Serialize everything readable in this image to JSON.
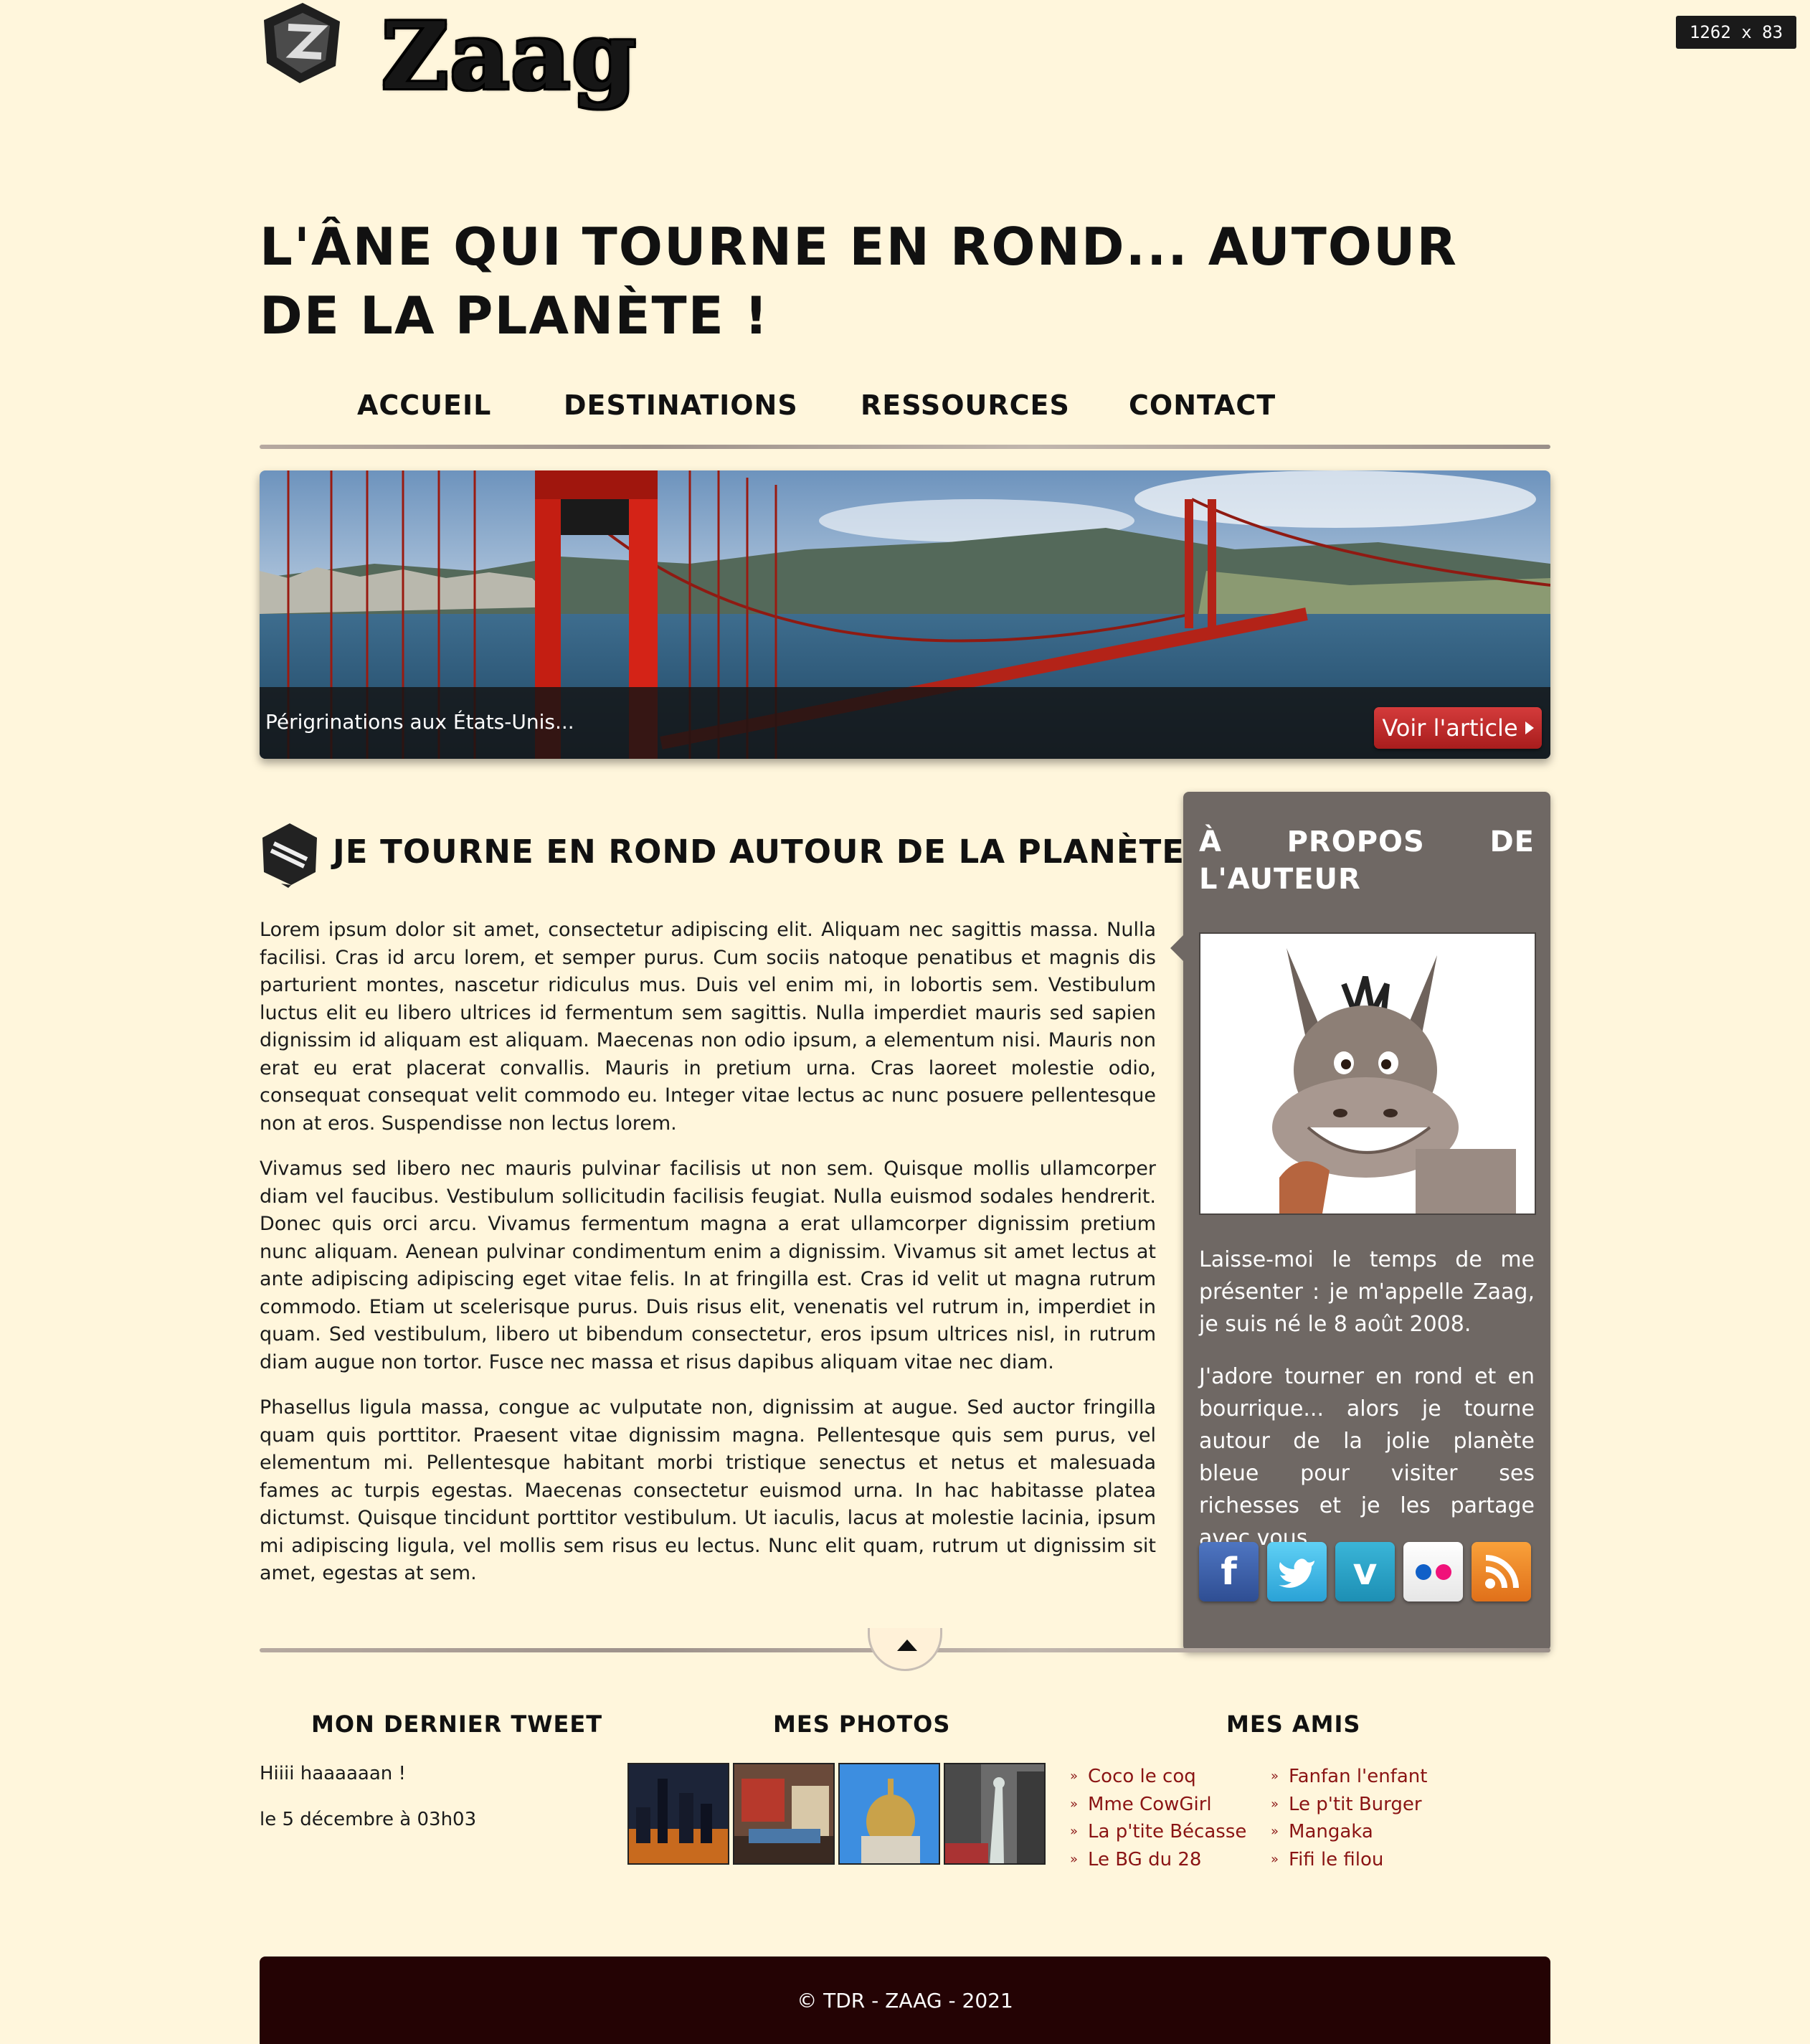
{
  "badge": {
    "resolution": "1262 x 83"
  },
  "header": {
    "logo_text": "Zaag",
    "site_title": "L'âne qui tourne en rond... autour de la planète !"
  },
  "nav": {
    "items": [
      "Accueil",
      "Destinations",
      "Ressources",
      "Contact"
    ]
  },
  "banner": {
    "caption": "Périgrinations aux États-Unis...",
    "button_label": "Voir l'article"
  },
  "article": {
    "title": "Je tourne en rond autour de la planète",
    "paragraphs": [
      "Lorem ipsum dolor sit amet, consectetur adipiscing elit. Aliquam nec sagittis massa. Nulla facilisi. Cras id arcu lorem, et semper purus. Cum sociis natoque penatibus et magnis dis parturient montes, nascetur ridiculus mus. Duis vel enim mi, in lobortis sem. Vestibulum luctus elit eu libero ultrices id fermentum sem sagittis. Nulla imperdiet mauris sed sapien dignissim id aliquam est aliquam. Maecenas non odio ipsum, a elementum nisi. Mauris non erat eu erat placerat convallis. Mauris in pretium urna. Cras laoreet molestie odio, consequat consequat velit commodo eu. Integer vitae lectus ac nunc posuere pellentesque non at eros. Suspendisse non lectus lorem.",
      "Vivamus sed libero nec mauris pulvinar facilisis ut non sem. Quisque mollis ullamcorper diam vel faucibus. Vestibulum sollicitudin facilisis feugiat. Nulla euismod sodales hendrerit. Donec quis orci arcu. Vivamus fermentum magna a erat ullamcorper dignissim pretium nunc aliquam. Aenean pulvinar condimentum enim a dignissim. Vivamus sit amet lectus at ante adipiscing adipiscing eget vitae felis. In at fringilla est. Cras id velit ut magna rutrum commodo. Etiam ut scelerisque purus. Duis risus elit, venenatis vel rutrum in, imperdiet in quam. Sed vestibulum, libero ut bibendum consectetur, eros ipsum ultrices nisl, in rutrum diam augue non tortor. Fusce nec massa et risus dapibus aliquam vitae nec diam.",
      "Phasellus ligula massa, congue ac vulputate non, dignissim at augue. Sed auctor fringilla quam quis porttitor. Praesent vitae dignissim magna. Pellentesque quis sem purus, vel elementum mi. Pellentesque habitant morbi tristique senectus et netus et malesuada fames ac turpis egestas. Maecenas consectetur euismod urna. In hac habitasse platea dictumst. Quisque tincidunt porttitor vestibulum. Ut iaculis, lacus at molestie lacinia, ipsum mi adipiscing ligula, vel mollis sem risus eu lectus. Nunc elit quam, rutrum ut dignissim sit amet, egestas at sem."
    ]
  },
  "sidebar": {
    "title_line1": "À propos de",
    "title_line2": "l'auteur",
    "paragraphs": [
      "Laisse-moi le temps de me présenter : je m'appelle Zaag, je suis né le 8 août 2008.",
      "J'adore tourner en rond et en bourrique... alors je tourne autour de la jolie planète bleue pour visiter ses richesses et je les partage avec vous."
    ],
    "social": [
      "facebook-icon",
      "twitter-icon",
      "vimeo-icon",
      "flickr-icon",
      "rss-icon"
    ]
  },
  "widgets": {
    "tweet": {
      "title": "Mon dernier tweet",
      "text": "Hiiii haaaaaan !",
      "date": "le 5 décembre à 03h03"
    },
    "photos": {
      "title": "Mes photos"
    },
    "friends": {
      "title": "Mes amis",
      "col1": [
        "Coco le coq",
        "Mme CowGirl",
        "La p'tite Bécasse",
        "Le BG du 28"
      ],
      "col2": [
        "Fanfan l'enfant",
        "Le p'tit Burger",
        "Mangaka",
        "Fifi le filou"
      ]
    }
  },
  "footer": {
    "copyright": "© TDR - ZAAG - 2021"
  },
  "colors": {
    "background": "#fff6dc",
    "sidebar": "#6f6864",
    "accent_red": "#a81d1d",
    "link": "#8a1414",
    "footer": "#240304"
  }
}
